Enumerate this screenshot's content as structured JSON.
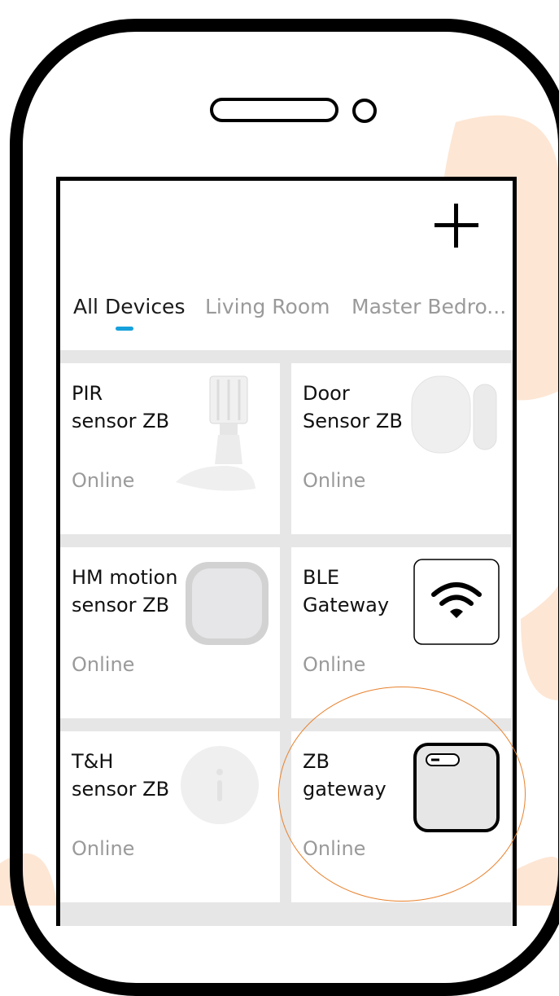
{
  "header": {
    "add_label": "+"
  },
  "tabs": [
    {
      "label": "All Devices",
      "active": true
    },
    {
      "label": "Living Room",
      "active": false
    },
    {
      "label": "Master Bedro...",
      "active": false
    }
  ],
  "devices": [
    {
      "name": "PIR\nsensor ZB",
      "status": "Online",
      "icon": "pir-sensor-image"
    },
    {
      "name": "Door\nSensor ZB",
      "status": "Online",
      "icon": "door-sensor-image"
    },
    {
      "name": "HM motion\nsensor ZB",
      "status": "Online",
      "icon": "motion-sensor-image"
    },
    {
      "name": "BLE\nGateway",
      "status": "Online",
      "icon": "wifi-icon"
    },
    {
      "name": "T&H\nsensor ZB",
      "status": "Online",
      "icon": "th-sensor-image"
    },
    {
      "name": "ZB\ngateway",
      "status": "Online",
      "icon": "zb-gateway-image"
    }
  ],
  "colors": {
    "accent": "#16a1dc",
    "annotation": "#e8822e",
    "background_deco": "#fde4d2"
  }
}
